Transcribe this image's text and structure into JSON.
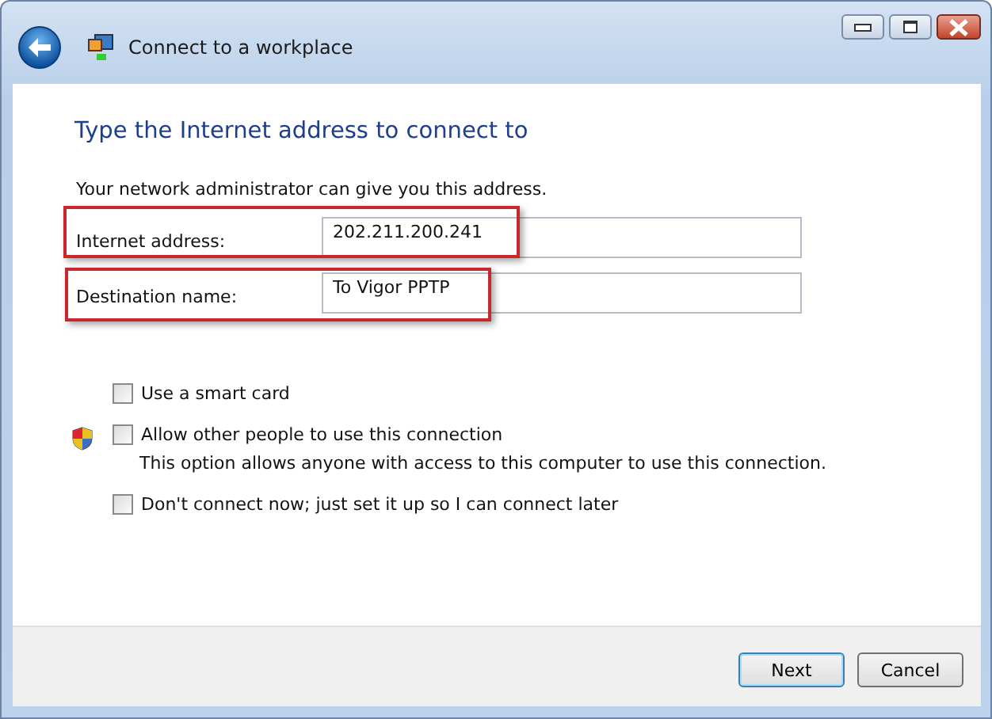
{
  "window": {
    "title": "Connect to a workplace"
  },
  "heading": "Type the Internet address to connect to",
  "description": "Your network administrator can give you this address.",
  "fields": [
    {
      "label": "Internet address:",
      "value": "202.211.200.241",
      "highlighted": true
    },
    {
      "label": "Destination name:",
      "value": "To Vigor PPTP",
      "highlighted": true
    }
  ],
  "options": [
    {
      "label": "Use a smart card",
      "checked": false,
      "shield": false
    },
    {
      "label": "Allow other people to use this connection",
      "checked": false,
      "shield": true,
      "note": "This option allows anyone with access to this computer to use this connection."
    },
    {
      "label": "Don't connect now; just set it up so I can connect later",
      "checked": false,
      "shield": false
    }
  ],
  "buttons": [
    {
      "label": "Next",
      "default": true
    },
    {
      "label": "Cancel",
      "default": false
    }
  ]
}
